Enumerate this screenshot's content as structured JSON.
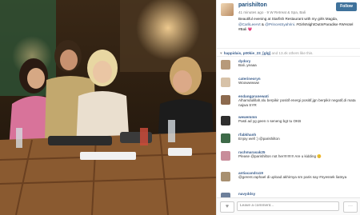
{
  "post": {
    "username": "parishilton",
    "meta": "41 minutes ago · 9 W Retreat & Spa, Bali",
    "follow_label": "Follow",
    "caption_1": "Beautiful evening at Starfish Restaurant with my girls Magda, ",
    "caption_m1": "@CarliLeeArt",
    "caption_2": " & ",
    "caption_m2": "@PrincesSyahrini",
    "caption_3": ". #GirlsNightOutInParadise #WHotel #Bali",
    "caption_heart": "💗"
  },
  "likes": {
    "heart": "♥",
    "users": "happidais, p00kie_23_[glg]",
    "rest": " and 13.4k others like this."
  },
  "comments": [
    {
      "user": "dydory",
      "text": "Bali..yeaaa"
    },
    {
      "user": "caterineoryn",
      "text": "Woowwwww"
    },
    {
      "user": "endangpranewati",
      "text": "Alhamdulillah,slu berpikir positif energi positif,jgn berpikir negatif,di mata najwa SYR"
    },
    {
      "user": "wewemmn",
      "text": "Pasti ad yg geen n seneng bgt tu OKB"
    },
    {
      "user": "rfabkhanh",
      "text": "Enjoy well :) @parishilton"
    },
    {
      "user": "rachmarasak25",
      "text": "Please @parishilton not her!!!!!!!!!! Are u kidding 😊"
    },
    {
      "user": "antiacandra19",
      "text": "@gerent.raphael di upload akhirnya sm paris say #nyessek liatnya"
    },
    {
      "user": "navyddsy",
      "text": ""
    }
  ],
  "footer": {
    "heart": "♥",
    "placeholder": "Leave a comment...",
    "more": "···"
  }
}
